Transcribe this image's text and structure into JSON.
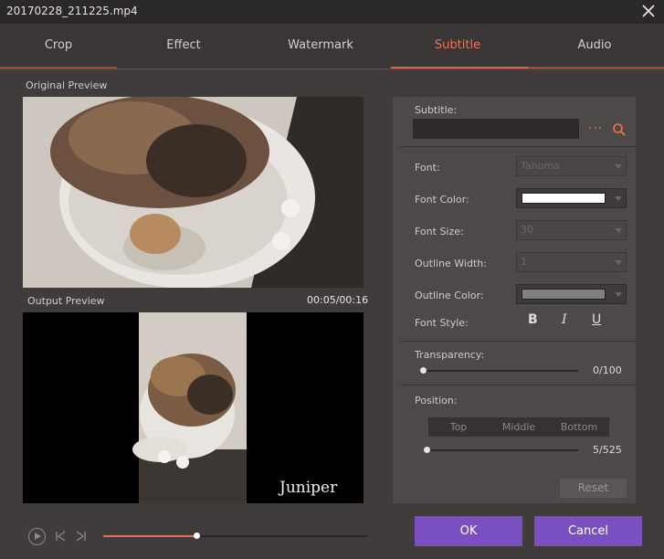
{
  "window": {
    "title": "20170228_211225.mp4"
  },
  "tabs": [
    {
      "label": "Crop"
    },
    {
      "label": "Effect"
    },
    {
      "label": "Watermark"
    },
    {
      "label": "Subtitle"
    },
    {
      "label": "Audio"
    }
  ],
  "active_tab": "Subtitle",
  "colors": {
    "accent": "#ef7355",
    "button": "#7a4fc0",
    "panel": "#4d4949",
    "background": "#403c3c"
  },
  "preview": {
    "original_label": "Original Preview",
    "output_label": "Output Preview",
    "time": "00:05/00:16",
    "watermark_text": "Juniper"
  },
  "subtitle": {
    "subtitle_label": "Subtitle:",
    "subtitle_value": "",
    "font_label": "Font:",
    "font_value": "Tahoma",
    "font_color_label": "Font Color:",
    "font_color_value": "#ffffff",
    "font_size_label": "Font Size:",
    "font_size_value": "30",
    "outline_width_label": "Outline Width:",
    "outline_width_value": "1",
    "outline_color_label": "Outline Color:",
    "outline_color_value": "#808080",
    "font_style_label": "Font Style:",
    "bold": "B",
    "italic": "I",
    "underline": "U",
    "transparency_label": "Transparency:",
    "transparency_value": "0/100",
    "transparency_fraction": 0,
    "position_label": "Position:",
    "position_options": [
      "Top",
      "Middle",
      "Bottom"
    ],
    "position_value": "5/525",
    "position_fraction": 0.01,
    "reset_label": "Reset"
  },
  "player": {
    "progress_fraction": 0.35
  },
  "actions": {
    "ok_label": "OK",
    "cancel_label": "Cancel"
  }
}
